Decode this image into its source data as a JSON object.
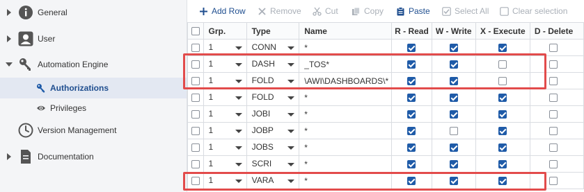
{
  "sidebar": {
    "items": [
      {
        "label": "General",
        "icon": "info-icon",
        "expand": "collapsed"
      },
      {
        "label": "User",
        "icon": "user-icon",
        "expand": "collapsed"
      },
      {
        "label": "Automation Engine",
        "icon": "key-icon",
        "expand": "expanded"
      },
      {
        "label": "Authorizations",
        "icon": "key-icon",
        "active": true
      },
      {
        "label": "Privileges",
        "icon": "eye-icon"
      },
      {
        "label": "Version Management",
        "icon": "clock-icon"
      },
      {
        "label": "Documentation",
        "icon": "document-icon",
        "expand": "collapsed"
      }
    ]
  },
  "toolbar": {
    "add_row": "Add Row",
    "remove": "Remove",
    "cut": "Cut",
    "copy": "Copy",
    "paste": "Paste",
    "select_all": "Select All",
    "clear_selection": "Clear selection"
  },
  "grid": {
    "headers": {
      "grp": "Grp.",
      "type": "Type",
      "name": "Name",
      "r": "R - Read",
      "w": "W - Write",
      "x": "X - Execute",
      "d": "D - Delete"
    },
    "rows": [
      {
        "grp": "1",
        "type": "CONN",
        "name": "*",
        "r": true,
        "w": true,
        "x": true
      },
      {
        "grp": "1",
        "type": "DASH",
        "name": "_TOS*",
        "r": true,
        "w": true,
        "x": false
      },
      {
        "grp": "1",
        "type": "FOLD",
        "name": "\\AWI\\DASHBOARDS\\*",
        "r": true,
        "w": true,
        "x": false
      },
      {
        "grp": "1",
        "type": "FOLD",
        "name": "*",
        "r": true,
        "w": true,
        "x": true
      },
      {
        "grp": "1",
        "type": "JOBI",
        "name": "*",
        "r": true,
        "w": true,
        "x": true
      },
      {
        "grp": "1",
        "type": "JOBP",
        "name": "*",
        "r": true,
        "w": false,
        "x": true
      },
      {
        "grp": "1",
        "type": "JOBS",
        "name": "*",
        "r": true,
        "w": true,
        "x": true
      },
      {
        "grp": "1",
        "type": "SCRI",
        "name": "*",
        "r": true,
        "w": true,
        "x": true
      },
      {
        "grp": "1",
        "type": "VARA",
        "name": "*",
        "r": true,
        "w": true,
        "x": true
      }
    ]
  },
  "colors": {
    "accent": "#1f4e8f",
    "checkbox": "#1f5ba8",
    "highlight": "#e24b4b"
  }
}
